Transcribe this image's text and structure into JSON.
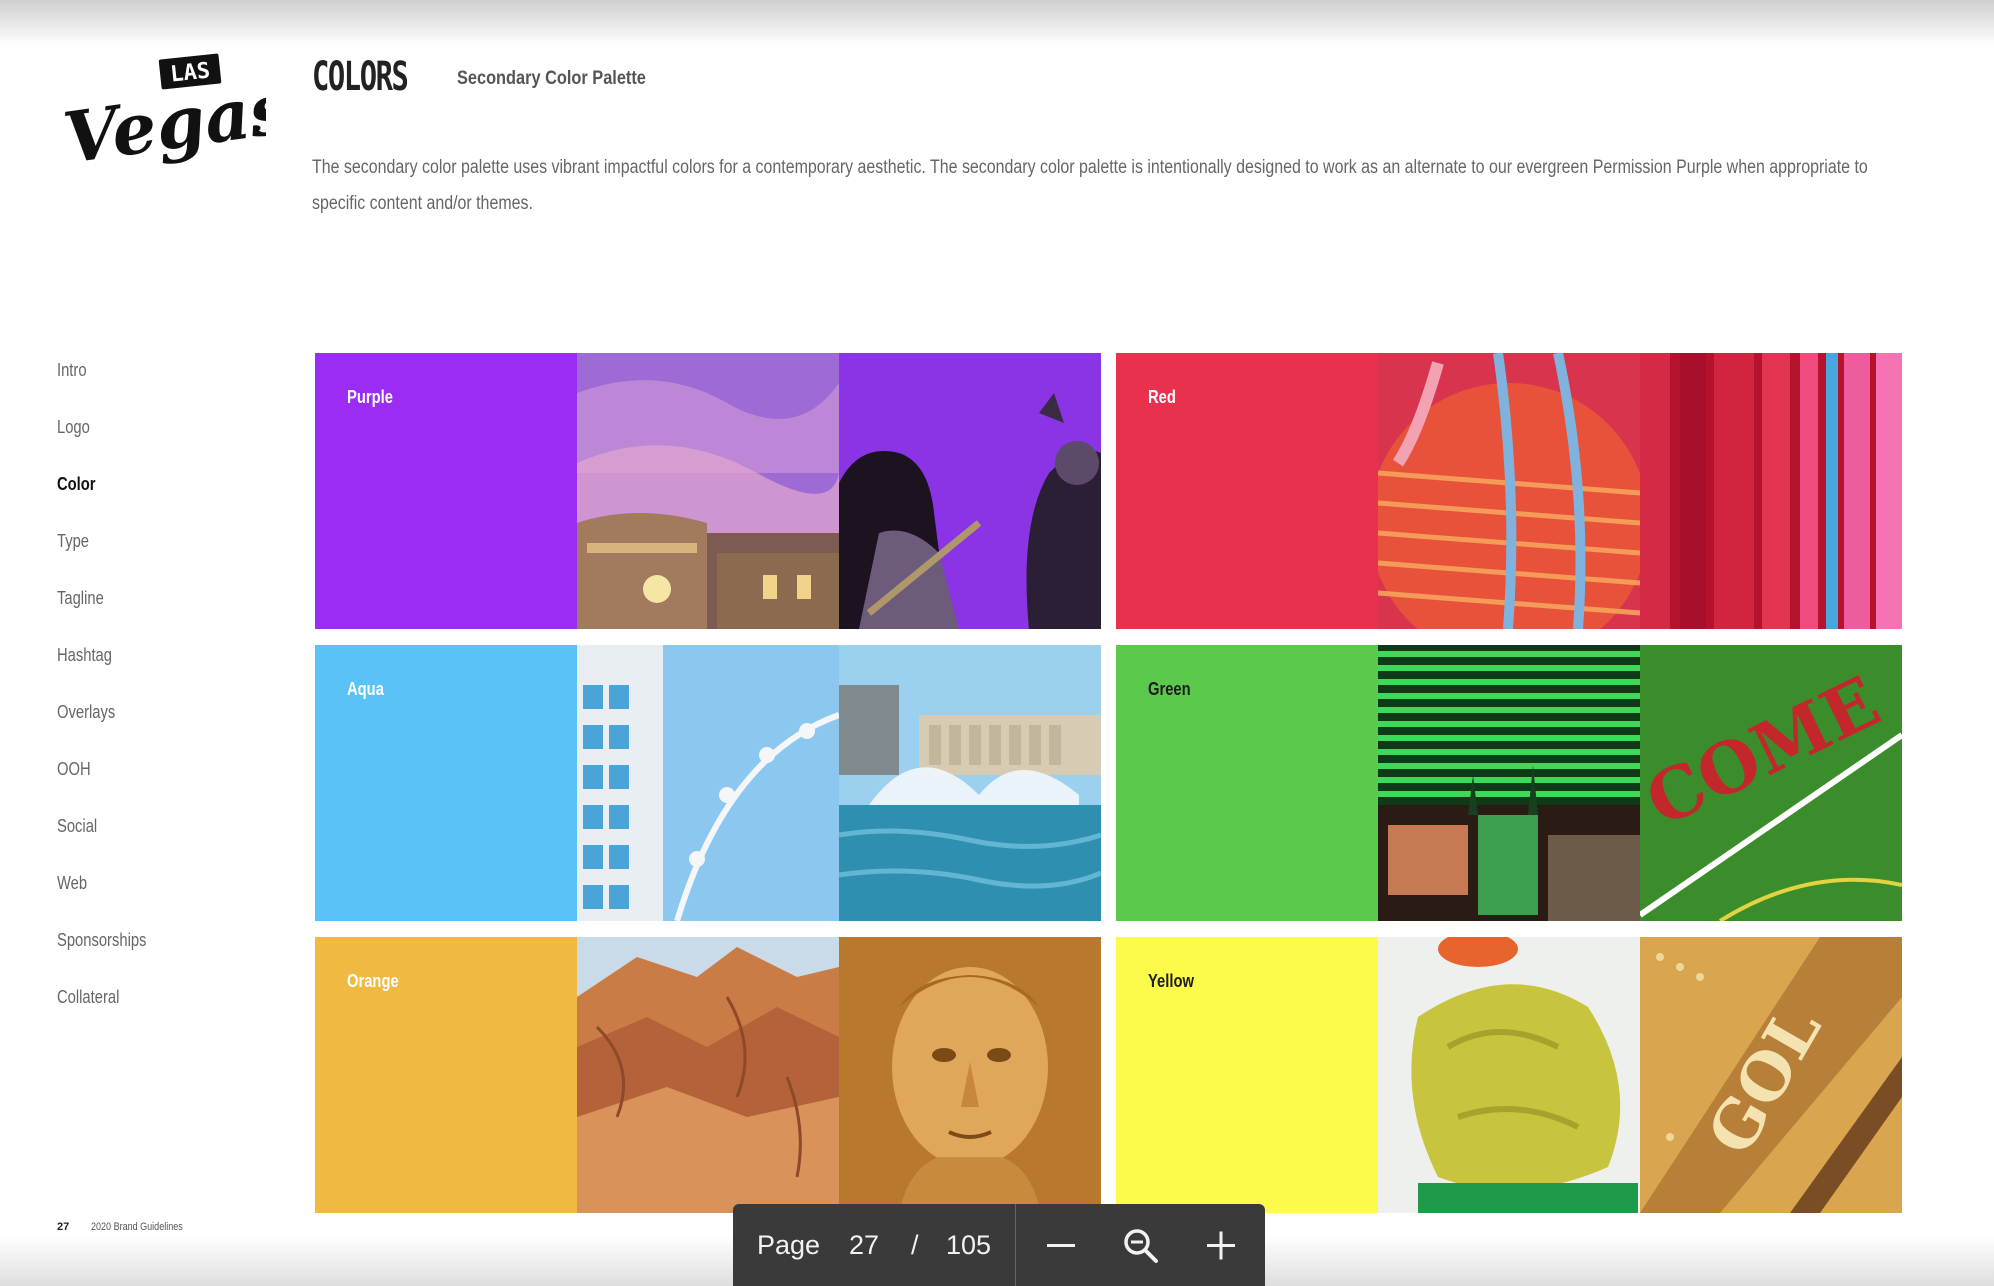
{
  "logo": {
    "las_text": "LAS",
    "vegas_text": "Vegas"
  },
  "header": {
    "title": "COLORS",
    "subtitle": "Secondary Color Palette",
    "description": "The secondary color palette uses vibrant impactful colors for a contemporary aesthetic. The secondary color palette is intentionally designed to work as an alternate to our evergreen Permission Purple when appropriate to specific content and/or themes."
  },
  "nav": {
    "items": [
      {
        "label": "Intro",
        "active": false
      },
      {
        "label": "Logo",
        "active": false
      },
      {
        "label": "Color",
        "active": true
      },
      {
        "label": "Type",
        "active": false
      },
      {
        "label": "Tagline",
        "active": false
      },
      {
        "label": "Hashtag",
        "active": false
      },
      {
        "label": "Overlays",
        "active": false
      },
      {
        "label": "OOH",
        "active": false
      },
      {
        "label": "Social",
        "active": false
      },
      {
        "label": "Web",
        "active": false
      },
      {
        "label": "Sponsorships",
        "active": false
      },
      {
        "label": "Collateral",
        "active": false
      }
    ]
  },
  "palette": [
    {
      "name": "Purple",
      "color": "#9a2cf3",
      "label_color": "light",
      "photos": [
        "purple-sky-building-photo",
        "purple-rock-concert-photo"
      ]
    },
    {
      "name": "Red",
      "color": "#e9304d",
      "label_color": "light",
      "photos": [
        "red-neon-sign-photo",
        "red-pink-pipes-photo"
      ]
    },
    {
      "name": "Aqua",
      "color": "#59c3f7",
      "label_color": "light",
      "photos": [
        "aqua-tower-ferris-wheel-photo",
        "aqua-bellagio-fountain-photo"
      ]
    },
    {
      "name": "Green",
      "color": "#5bc94c",
      "label_color": "dark",
      "photos": [
        "green-mgm-building-photo",
        "green-craps-table-photo"
      ]
    },
    {
      "name": "Orange",
      "color": "#f0b942",
      "label_color": "light",
      "photos": [
        "orange-red-rock-photo",
        "orange-caesar-bust-photo"
      ]
    },
    {
      "name": "Yellow",
      "color": "#fcfa4a",
      "label_color": "dark",
      "photos": [
        "yellow-lime-sculpture-photo",
        "yellow-gold-sign-photo"
      ]
    }
  ],
  "footer": {
    "page_number": "27",
    "doc_title": "2020 Brand Guidelines"
  },
  "viewer": {
    "page_label": "Page",
    "current_page": "27",
    "separator": "/",
    "total_pages": "105",
    "icons": [
      "zoom-out-icon",
      "magnifier-icon",
      "zoom-in-icon"
    ]
  }
}
